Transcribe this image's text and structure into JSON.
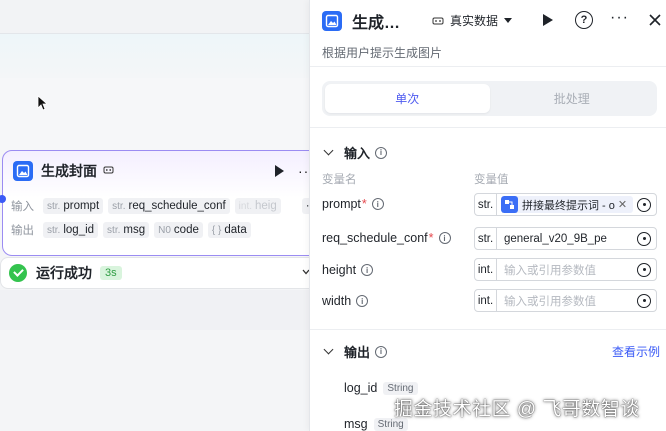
{
  "node": {
    "title": "生成封面",
    "inputs_label": "输入",
    "outputs_label": "输出",
    "inputs": [
      {
        "type": "str.",
        "name": "prompt"
      },
      {
        "type": "str.",
        "name": "req_schedule_conf"
      },
      {
        "type": "int.",
        "name": "heig"
      }
    ],
    "outputs": [
      {
        "type": "str.",
        "name": "log_id"
      },
      {
        "type": "str.",
        "name": "msg"
      },
      {
        "type": "N0",
        "name": "code"
      },
      {
        "type": "{ }",
        "name": "data"
      }
    ],
    "more": "···"
  },
  "run_status": {
    "text": "运行成功",
    "duration": "3s"
  },
  "panel": {
    "title": "生成…",
    "mode": "真实数据",
    "description": "根据用户提示生成图片",
    "tabs": [
      {
        "label": "单次",
        "active": true
      },
      {
        "label": "批处理",
        "active": false
      }
    ],
    "input_section": {
      "title": "输入",
      "col_name": "变量名",
      "col_value": "变量值",
      "params": [
        {
          "name": "prompt",
          "required": true,
          "type": "str.",
          "ref": "拼接最终提示词 - o",
          "value": "",
          "placeholder": ""
        },
        {
          "name": "req_schedule_conf",
          "required": true,
          "type": "str.",
          "value": "general_v20_9B_pe",
          "placeholder": ""
        },
        {
          "name": "height",
          "required": false,
          "type": "int.",
          "value": "",
          "placeholder": "输入或引用参数值"
        },
        {
          "name": "width",
          "required": false,
          "type": "int.",
          "value": "",
          "placeholder": "输入或引用参数值"
        }
      ]
    },
    "output_section": {
      "title": "输出",
      "example_link": "查看示例",
      "fields": [
        {
          "name": "log_id",
          "type": "String"
        },
        {
          "name": "msg",
          "type": "String"
        }
      ]
    }
  },
  "watermark": "掘金技术社区 @ 飞哥数智谈",
  "colors": {
    "accent": "#4e5bf0",
    "app_icon": "#2b6cf5",
    "success": "#34c34e",
    "required": "#e5484d"
  }
}
